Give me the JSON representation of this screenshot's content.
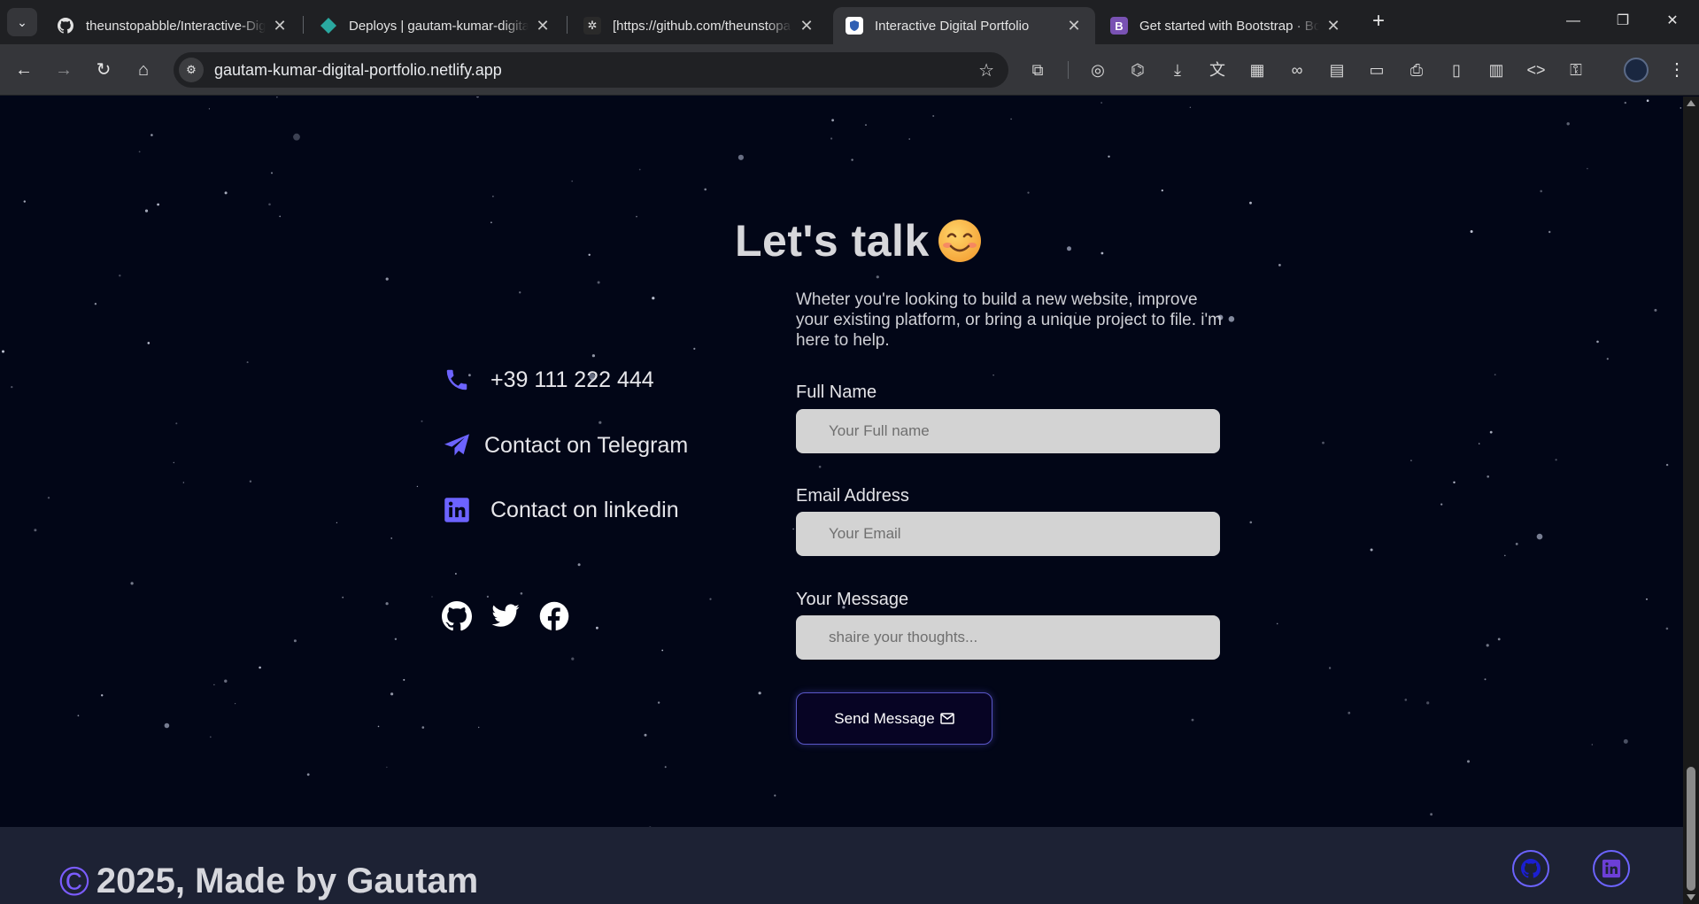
{
  "browser": {
    "tabs": [
      {
        "title": "theunstopabble/Interactive-Dig",
        "favicon": "github-icon",
        "active": false
      },
      {
        "title": "Deploys | gautam-kumar-digital",
        "favicon": "netlify-icon",
        "active": false
      },
      {
        "title": "[https://github.com/theunstopa",
        "favicon": "app-icon",
        "active": false
      },
      {
        "title": "Interactive Digital Portfolio",
        "favicon": "shield-icon",
        "active": true
      },
      {
        "title": "Get started with Bootstrap · Boo",
        "favicon": "bootstrap-icon",
        "active": false
      }
    ],
    "url": "gautam-kumar-digital-portfolio.netlify.app"
  },
  "page": {
    "heading": "Let's talk",
    "intro": "Wheter you're looking to build a new website, improve your existing platform, or bring a unique project to file. i'm here to help.",
    "contacts": [
      {
        "label": "+39 111 222 444",
        "icon": "phone-icon"
      },
      {
        "label": "Contact on Telegram",
        "icon": "telegram-icon"
      },
      {
        "label": "Contact on linkedin",
        "icon": "linkedin-icon"
      }
    ],
    "socials": [
      "github-icon",
      "twitter-icon",
      "facebook-icon"
    ],
    "form": {
      "name_label": "Full Name",
      "name_placeholder": "Your Full name",
      "email_label": "Email Address",
      "email_placeholder": "Your Email",
      "message_label": "Your Message",
      "message_placeholder": "shaire your thoughts...",
      "send_label": "Send Message"
    },
    "footer": {
      "text": "2025, Made by Gautam"
    }
  },
  "colors": {
    "background": "#020617",
    "accent": "#6c63ff",
    "field": "#d3d3d3",
    "footer": "#1d2234"
  }
}
